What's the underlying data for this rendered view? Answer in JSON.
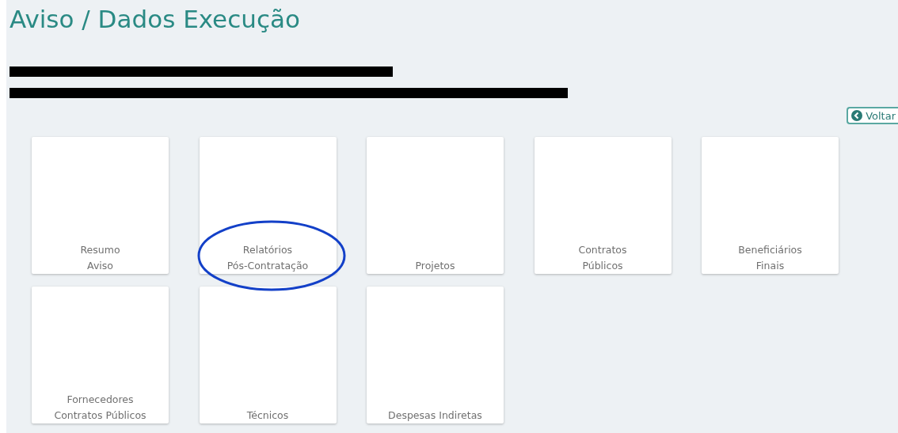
{
  "title": "Aviso / Dados Execução",
  "redacted_lines": [
    {
      "kind": "short"
    },
    {
      "kind": "long"
    }
  ],
  "back_button": {
    "label": "Voltar"
  },
  "cards": [
    {
      "lines": [
        "Resumo",
        "Aviso"
      ],
      "circled": false
    },
    {
      "lines": [
        "Relatórios",
        "Pós-Contratação"
      ],
      "circled": true
    },
    {
      "lines": [
        "Projetos"
      ],
      "circled": false
    },
    {
      "lines": [
        "Contratos",
        "Públicos"
      ],
      "circled": false
    },
    {
      "lines": [
        "Beneficiários",
        "Finais"
      ],
      "circled": false
    },
    {
      "lines": [
        "Fornecedores",
        "Contratos Públicos"
      ],
      "circled": false
    },
    {
      "lines": [
        "Técnicos"
      ],
      "circled": false
    },
    {
      "lines": [
        "Despesas Indiretas"
      ],
      "circled": false
    }
  ]
}
